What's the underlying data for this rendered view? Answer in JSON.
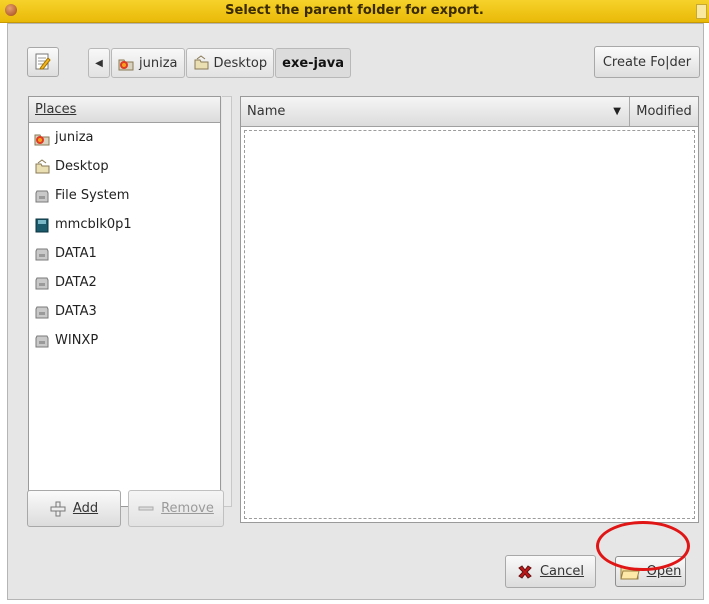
{
  "window": {
    "title": "Select the parent folder for export."
  },
  "toolbar": {
    "breadcrumb": [
      {
        "label": "juniza",
        "icon": "home-folder-icon"
      },
      {
        "label": "Desktop",
        "icon": "desktop-folder-icon"
      },
      {
        "label": "exe-java"
      }
    ],
    "create_folder_label": "Create Fo|der"
  },
  "places": {
    "header": "Places",
    "items": [
      {
        "label": "juniza",
        "icon": "home-folder-icon"
      },
      {
        "label": "Desktop",
        "icon": "desktop-folder-icon"
      },
      {
        "label": "File System",
        "icon": "drive-icon"
      },
      {
        "label": "mmcblk0p1",
        "icon": "removable-drive-icon"
      },
      {
        "label": "DATA1",
        "icon": "drive-icon"
      },
      {
        "label": "DATA2",
        "icon": "drive-icon"
      },
      {
        "label": "DATA3",
        "icon": "drive-icon"
      },
      {
        "label": "WINXP",
        "icon": "drive-icon"
      }
    ],
    "add_label": "Add",
    "remove_label": "Remove"
  },
  "files": {
    "columns": [
      "Name",
      "Modified"
    ]
  },
  "actions": {
    "cancel_label": "Cancel",
    "open_label": "Open"
  },
  "colors": {
    "titlebar": "#f0c518",
    "highlight_ring": "#e01515"
  }
}
